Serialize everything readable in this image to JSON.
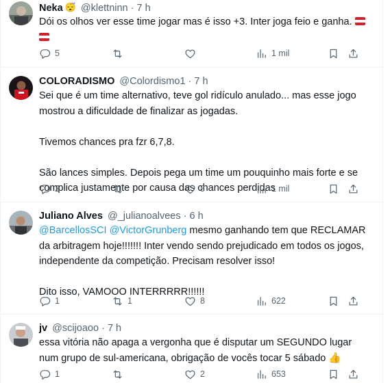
{
  "tweets": [
    {
      "name": "Neka",
      "name_emoji": "😴",
      "handle": "@klettninn",
      "dot": "·",
      "time": "7 h",
      "text": "Dói os olhos ver esse time jogar mas é isso +3. Inter joga feio e ganha.",
      "replies": "5",
      "retweets": "",
      "likes": "",
      "views": "1 mil"
    },
    {
      "name": "COLORADISMO",
      "handle": "@Colordismo1",
      "dot": "·",
      "time": "7 h",
      "paragraphs": [
        "Sei que é um time alternativo, teve gol ridículo anulado... mas esse jogo mostrou a dificuldade de finalizar as jogadas.",
        "Tivemos chances pra fzr 6,7,8.",
        "São lances simples. Depois pega um time um pouquinho mais forte e se complica justamente por causa das chances perdidas"
      ],
      "replies": "2",
      "retweets": "",
      "likes": "8",
      "views": "1 mil"
    },
    {
      "name": "Juliano Alves",
      "handle": "@_julianoalvees",
      "dot": "·",
      "time": "6 h",
      "mention1": "@BarcellosSCI",
      "mention2": "@VictorGrunberg",
      "text_after_mentions": "mesmo ganhando tem que RECLAMAR da arbitragem hoje!!!!!!! Inter vendo sendo prejudicado em todos os jogos, independente da competição. Precisam resolver isso!",
      "text2": "Dito isso, VAMOOO INTERRRRR!!!!!!",
      "replies": "1",
      "retweets": "1",
      "likes": "8",
      "views": "622"
    },
    {
      "name": "jv",
      "handle": "@scijoaoo",
      "dot": "·",
      "time": "7 h",
      "text": "essa vitória não apaga a vergonha que é disputar um SEGUNDO lugar num grupo de sul-americana, obrigação de vocês tocar 5 sábado",
      "text_emoji": "👍",
      "replies": "1",
      "retweets": "",
      "likes": "2",
      "views": "653"
    }
  ],
  "colors": {
    "text": "#0f1419",
    "secondary": "#536471",
    "link": "#1d9bf0",
    "divider": "#eff3f4"
  },
  "icons": [
    "reply-icon",
    "retweet-icon",
    "like-icon",
    "views-icon",
    "bookmark-icon",
    "share-icon",
    "flag-icon"
  ]
}
